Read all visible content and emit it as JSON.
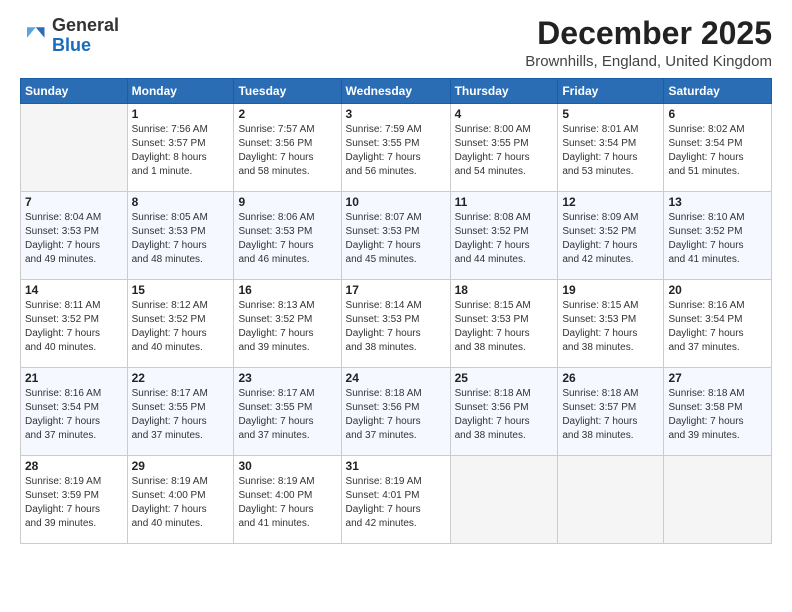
{
  "header": {
    "logo_general": "General",
    "logo_blue": "Blue",
    "month_title": "December 2025",
    "location": "Brownhills, England, United Kingdom"
  },
  "days_of_week": [
    "Sunday",
    "Monday",
    "Tuesday",
    "Wednesday",
    "Thursday",
    "Friday",
    "Saturday"
  ],
  "weeks": [
    [
      {
        "day": "",
        "info": ""
      },
      {
        "day": "1",
        "info": "Sunrise: 7:56 AM\nSunset: 3:57 PM\nDaylight: 8 hours\nand 1 minute."
      },
      {
        "day": "2",
        "info": "Sunrise: 7:57 AM\nSunset: 3:56 PM\nDaylight: 7 hours\nand 58 minutes."
      },
      {
        "day": "3",
        "info": "Sunrise: 7:59 AM\nSunset: 3:55 PM\nDaylight: 7 hours\nand 56 minutes."
      },
      {
        "day": "4",
        "info": "Sunrise: 8:00 AM\nSunset: 3:55 PM\nDaylight: 7 hours\nand 54 minutes."
      },
      {
        "day": "5",
        "info": "Sunrise: 8:01 AM\nSunset: 3:54 PM\nDaylight: 7 hours\nand 53 minutes."
      },
      {
        "day": "6",
        "info": "Sunrise: 8:02 AM\nSunset: 3:54 PM\nDaylight: 7 hours\nand 51 minutes."
      }
    ],
    [
      {
        "day": "7",
        "info": "Sunrise: 8:04 AM\nSunset: 3:53 PM\nDaylight: 7 hours\nand 49 minutes."
      },
      {
        "day": "8",
        "info": "Sunrise: 8:05 AM\nSunset: 3:53 PM\nDaylight: 7 hours\nand 48 minutes."
      },
      {
        "day": "9",
        "info": "Sunrise: 8:06 AM\nSunset: 3:53 PM\nDaylight: 7 hours\nand 46 minutes."
      },
      {
        "day": "10",
        "info": "Sunrise: 8:07 AM\nSunset: 3:53 PM\nDaylight: 7 hours\nand 45 minutes."
      },
      {
        "day": "11",
        "info": "Sunrise: 8:08 AM\nSunset: 3:52 PM\nDaylight: 7 hours\nand 44 minutes."
      },
      {
        "day": "12",
        "info": "Sunrise: 8:09 AM\nSunset: 3:52 PM\nDaylight: 7 hours\nand 42 minutes."
      },
      {
        "day": "13",
        "info": "Sunrise: 8:10 AM\nSunset: 3:52 PM\nDaylight: 7 hours\nand 41 minutes."
      }
    ],
    [
      {
        "day": "14",
        "info": "Sunrise: 8:11 AM\nSunset: 3:52 PM\nDaylight: 7 hours\nand 40 minutes."
      },
      {
        "day": "15",
        "info": "Sunrise: 8:12 AM\nSunset: 3:52 PM\nDaylight: 7 hours\nand 40 minutes."
      },
      {
        "day": "16",
        "info": "Sunrise: 8:13 AM\nSunset: 3:52 PM\nDaylight: 7 hours\nand 39 minutes."
      },
      {
        "day": "17",
        "info": "Sunrise: 8:14 AM\nSunset: 3:53 PM\nDaylight: 7 hours\nand 38 minutes."
      },
      {
        "day": "18",
        "info": "Sunrise: 8:15 AM\nSunset: 3:53 PM\nDaylight: 7 hours\nand 38 minutes."
      },
      {
        "day": "19",
        "info": "Sunrise: 8:15 AM\nSunset: 3:53 PM\nDaylight: 7 hours\nand 38 minutes."
      },
      {
        "day": "20",
        "info": "Sunrise: 8:16 AM\nSunset: 3:54 PM\nDaylight: 7 hours\nand 37 minutes."
      }
    ],
    [
      {
        "day": "21",
        "info": "Sunrise: 8:16 AM\nSunset: 3:54 PM\nDaylight: 7 hours\nand 37 minutes."
      },
      {
        "day": "22",
        "info": "Sunrise: 8:17 AM\nSunset: 3:55 PM\nDaylight: 7 hours\nand 37 minutes."
      },
      {
        "day": "23",
        "info": "Sunrise: 8:17 AM\nSunset: 3:55 PM\nDaylight: 7 hours\nand 37 minutes."
      },
      {
        "day": "24",
        "info": "Sunrise: 8:18 AM\nSunset: 3:56 PM\nDaylight: 7 hours\nand 37 minutes."
      },
      {
        "day": "25",
        "info": "Sunrise: 8:18 AM\nSunset: 3:56 PM\nDaylight: 7 hours\nand 38 minutes."
      },
      {
        "day": "26",
        "info": "Sunrise: 8:18 AM\nSunset: 3:57 PM\nDaylight: 7 hours\nand 38 minutes."
      },
      {
        "day": "27",
        "info": "Sunrise: 8:18 AM\nSunset: 3:58 PM\nDaylight: 7 hours\nand 39 minutes."
      }
    ],
    [
      {
        "day": "28",
        "info": "Sunrise: 8:19 AM\nSunset: 3:59 PM\nDaylight: 7 hours\nand 39 minutes."
      },
      {
        "day": "29",
        "info": "Sunrise: 8:19 AM\nSunset: 4:00 PM\nDaylight: 7 hours\nand 40 minutes."
      },
      {
        "day": "30",
        "info": "Sunrise: 8:19 AM\nSunset: 4:00 PM\nDaylight: 7 hours\nand 41 minutes."
      },
      {
        "day": "31",
        "info": "Sunrise: 8:19 AM\nSunset: 4:01 PM\nDaylight: 7 hours\nand 42 minutes."
      },
      {
        "day": "",
        "info": ""
      },
      {
        "day": "",
        "info": ""
      },
      {
        "day": "",
        "info": ""
      }
    ]
  ],
  "week_row_classes": [
    "week-row-1",
    "week-row-2",
    "week-row-3",
    "week-row-4",
    "week-row-5"
  ]
}
